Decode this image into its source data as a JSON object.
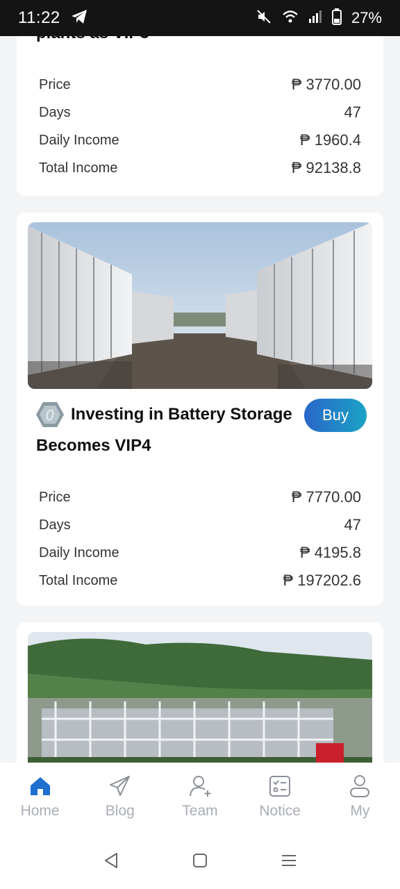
{
  "status_bar": {
    "time": "11:22",
    "battery": "27%",
    "icons": [
      "telegram-icon",
      "mute-icon",
      "wifi-icon",
      "signal-icon",
      "battery-icon"
    ]
  },
  "cards": [
    {
      "title_cut": "plants as VIP3",
      "stats": [
        {
          "label": "Price",
          "value": "₱ 3770.00"
        },
        {
          "label": "Days",
          "value": "47"
        },
        {
          "label": "Daily Income",
          "value": "₱ 1960.4"
        },
        {
          "label": "Total Income",
          "value": "₱ 92138.8"
        }
      ]
    },
    {
      "title_line1": "Investing in Battery Storage",
      "title_line2": "Becomes VIP4",
      "buy_label": "Buy",
      "stats": [
        {
          "label": "Price",
          "value": "₱ 7770.00"
        },
        {
          "label": "Days",
          "value": "47"
        },
        {
          "label": "Daily Income",
          "value": "₱ 4195.8"
        },
        {
          "label": "Total Income",
          "value": "₱ 197202.6"
        }
      ]
    }
  ],
  "bottom_nav": [
    {
      "label": "Home",
      "icon": "home-icon",
      "active": true
    },
    {
      "label": "Blog",
      "icon": "paper-plane-icon",
      "active": false
    },
    {
      "label": "Team",
      "icon": "add-user-icon",
      "active": false
    },
    {
      "label": "Notice",
      "icon": "checklist-icon",
      "active": false
    },
    {
      "label": "My",
      "icon": "profile-icon",
      "active": false
    }
  ],
  "colors": {
    "accent": "#1f6fd1",
    "buy_gradient_start": "#2a66c9",
    "buy_gradient_end": "#1aa3c5",
    "nav_inactive": "#a9adb5",
    "background": "#f3f4f6"
  }
}
